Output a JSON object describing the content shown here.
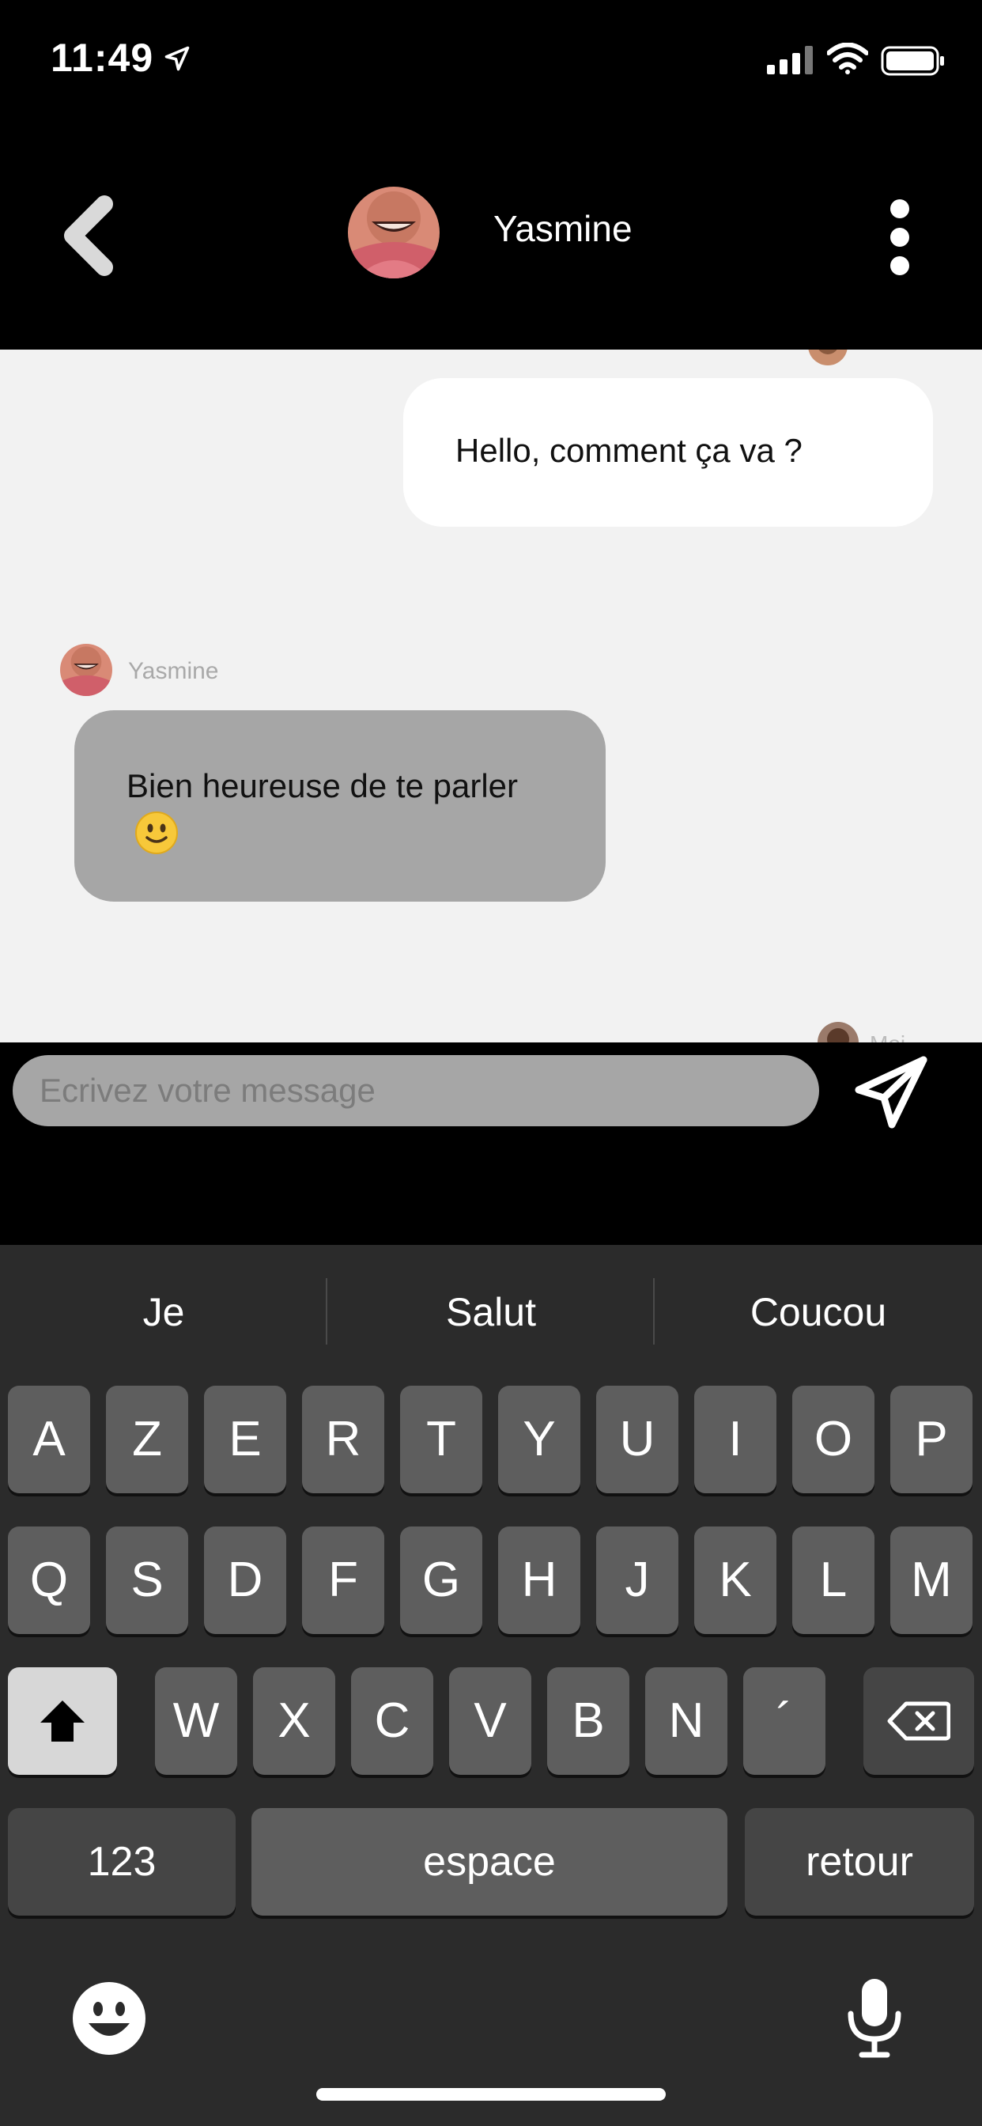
{
  "status_bar": {
    "time": "11:49"
  },
  "header": {
    "contact_name": "Yasmine"
  },
  "messages": {
    "outgoing_1": "Hello, comment ça va ?",
    "incoming_sender": "Yasmine",
    "incoming_1": "Bien heureuse de te parler",
    "incoming_1_emoji": "slightly-smiling-face",
    "peek_label": "Moi"
  },
  "composer": {
    "placeholder": "Ecrivez votre message",
    "value": ""
  },
  "keyboard": {
    "suggestions": [
      "Je",
      "Salut",
      "Coucou"
    ],
    "row1": [
      "A",
      "Z",
      "E",
      "R",
      "T",
      "Y",
      "U",
      "I",
      "O",
      "P"
    ],
    "row2": [
      "Q",
      "S",
      "D",
      "F",
      "G",
      "H",
      "J",
      "K",
      "L",
      "M"
    ],
    "row3": [
      "W",
      "X",
      "C",
      "V",
      "B",
      "N",
      "´"
    ],
    "numbers_label": "123",
    "space_label": "espace",
    "return_label": "retour"
  },
  "colors": {
    "background": "#000000",
    "chat_background": "#f2f2f2",
    "outgoing_bubble": "#ffffff",
    "incoming_bubble": "#a6a6a6",
    "keyboard_background": "#2b2b2b",
    "key": "#5e5e5e"
  },
  "icons": {
    "back": "chevron-left-icon",
    "more": "more-vertical-icon",
    "send": "paper-plane-icon",
    "shift": "shift-arrow-icon",
    "delete": "backspace-icon",
    "emoji": "emoji-icon",
    "mic": "microphone-icon"
  }
}
